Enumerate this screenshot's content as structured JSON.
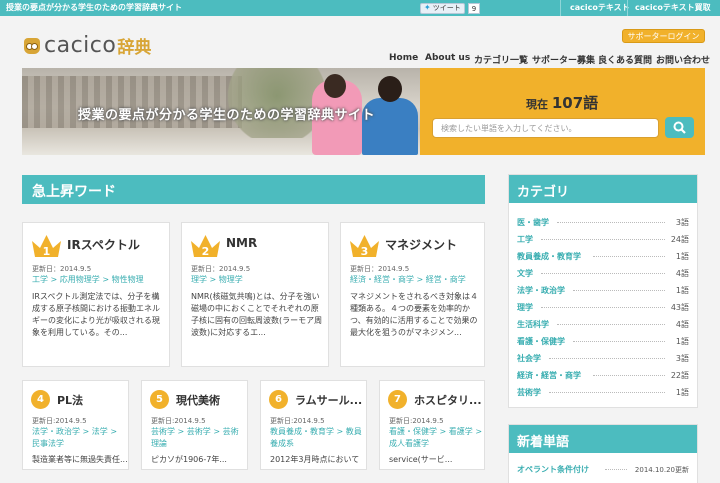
{
  "topbar": {
    "tagline": "授業の要点が分かる学生のための学習辞典サイト",
    "tweet_label": "ツイート",
    "tweet_count": "9",
    "links": [
      "cacicoテキスト",
      "cacicoテキスト買取"
    ]
  },
  "logo": {
    "word": "cacico",
    "ja": "辞典"
  },
  "supporter_login": "サポーターログイン",
  "nav": [
    "Home",
    "About us",
    "カテゴリ一覧",
    "サポーター募集",
    "良くある質問",
    "お問い合わせ"
  ],
  "hero": {
    "catchcopy": "授業の要点が分かる学生のための学習辞典サイト",
    "count_prefix": "現在",
    "count_value": "107語",
    "search_placeholder": "検索したい単語を入力してください。"
  },
  "trending": {
    "heading": "急上昇ワード",
    "top": [
      {
        "rank": "1",
        "title": "IRスペクトル",
        "date": "更新日：2014.9.5",
        "cats": "工学 > 応用物理学 > 物性物理",
        "excerpt": "IRスペクトル測定法では、分子を構成する原子核間における振動エネルギーの変化により光が吸収される現象を利用している。その..."
      },
      {
        "rank": "2",
        "title": "NMR",
        "date": "更新日：2014.9.5",
        "cats": "理学 > 物理学",
        "excerpt": "NMR(核磁気共鳴)とは、分子を強い磁場の中におくことでそれぞれの原子核に固有の回転周波数(ラーモア周波数)に対応するエ..."
      },
      {
        "rank": "3",
        "title": "マネジメント",
        "date": "更新日：2014.9.5",
        "cats": "経済・経営・商学 > 経営・商学",
        "excerpt": "マネジメントをされるべき対象は４種類ある。４つの要素を効率的かつ、有効的に活用することで効果の最大化を狙うのがマネジメン..."
      }
    ],
    "small": [
      {
        "rank": "4",
        "title": "PL法",
        "date": "更新日:2014.9.5",
        "cats": "法学・政治学 > 法学 > 民事法学",
        "excerpt": "製造業者等に無過失責任..."
      },
      {
        "rank": "5",
        "title": "現代美術",
        "date": "更新日:2014.9.5",
        "cats": "芸術学 > 芸術学 > 芸術理論",
        "excerpt": "ピカソが1906-7年..."
      },
      {
        "rank": "6",
        "title": "ラムサール...",
        "date": "更新日:2014.9.5",
        "cats": "教員養成・教育学 > 教員養成系",
        "excerpt": "2012年3月時点において"
      },
      {
        "rank": "7",
        "title": "ホスピタリ...",
        "date": "更新日:2014.9.5",
        "cats": "看護・保健学 > 看護学 > 成人看護学",
        "excerpt": "service(サービ..."
      }
    ]
  },
  "categories": {
    "heading": "カテゴリ",
    "items": [
      {
        "label": "医・歯学",
        "count": "3語"
      },
      {
        "label": "工学",
        "count": "24語"
      },
      {
        "label": "教員養成・教育学",
        "count": "1語"
      },
      {
        "label": "文学",
        "count": "4語"
      },
      {
        "label": "法学・政治学",
        "count": "1語"
      },
      {
        "label": "理学",
        "count": "43語"
      },
      {
        "label": "生活科学",
        "count": "4語"
      },
      {
        "label": "看護・保健学",
        "count": "1語"
      },
      {
        "label": "社会学",
        "count": "3語"
      },
      {
        "label": "経済・経営・商学",
        "count": "22語"
      },
      {
        "label": "芸術学",
        "count": "1語"
      }
    ]
  },
  "new_words": {
    "heading": "新着単語",
    "items": [
      {
        "label": "オペラント条件付け",
        "date": "2014.10.20更新"
      }
    ]
  },
  "colors": {
    "teal": "#4cbcbf",
    "gold": "#f1b12b"
  }
}
